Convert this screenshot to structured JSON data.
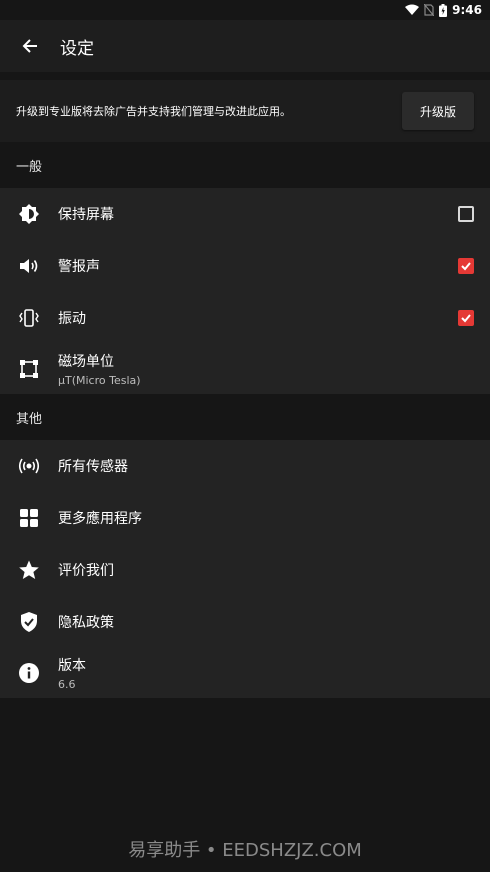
{
  "status": {
    "time": "9:46"
  },
  "appbar": {
    "title": "设定"
  },
  "promo": {
    "message": "升级到专业版将去除广告并支持我们管理与改进此应用。",
    "button": "升级版"
  },
  "sections": {
    "general": {
      "header": "一般",
      "items": [
        {
          "label": "保持屏幕",
          "checked": false
        },
        {
          "label": "警报声",
          "checked": true
        },
        {
          "label": "振动",
          "checked": true
        },
        {
          "label": "磁场单位",
          "sub": "μT(Micro Tesla)"
        }
      ]
    },
    "other": {
      "header": "其他",
      "items": [
        {
          "label": "所有传感器"
        },
        {
          "label": "更多應用程序"
        },
        {
          "label": "评价我们"
        },
        {
          "label": "隐私政策"
        },
        {
          "label": "版本",
          "sub": "6.6"
        }
      ]
    }
  },
  "colors": {
    "accent": "#e53935",
    "background": "#161616",
    "card": "#232323"
  },
  "watermark": "易享助手 • EEDSHZJZ.COM"
}
